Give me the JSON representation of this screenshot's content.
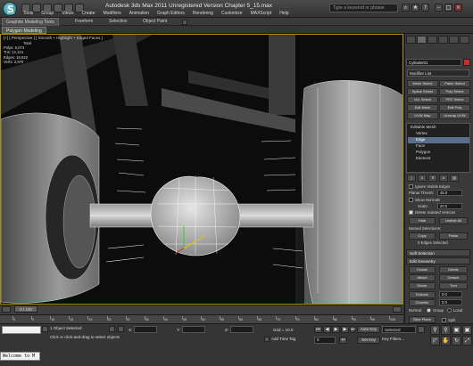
{
  "titlebar": {
    "title": "Autodesk 3ds Max  2011     Unregistered Version     Chapter 5_15.max",
    "search_placeholder": "Type a keyword or phrase",
    "menu": [
      "Edit",
      "Tools",
      "Group",
      "Views",
      "Create",
      "Modifiers",
      "Animation",
      "Graph Editors",
      "Rendering",
      "Customize",
      "MAXScript",
      "Help"
    ]
  },
  "ribbon": {
    "tabs": [
      "Graphite Modeling Tools",
      "Freeform",
      "Selection",
      "Object Paint"
    ],
    "sub_label": "Polygon Modeling"
  },
  "viewport": {
    "label": "[+] [ Perspective ] [ Smooth + Highlight + Edged Faces ]",
    "stats": {
      "header": "Total",
      "rows": [
        {
          "label": "Polys:",
          "value": "6,074"
        },
        {
          "label": "Tris:",
          "value": "12,124"
        },
        {
          "label": "Edges:",
          "value": "18,922"
        },
        {
          "label": "Verts:",
          "value": "2,970"
        }
      ]
    }
  },
  "panel": {
    "object_name": "Cylinder01",
    "modifier_list": "Modifier List",
    "buttons": [
      [
        "Mesh Select",
        "Patch Select"
      ],
      [
        "Spline Select",
        "Poly Select"
      ],
      [
        "Vol. Select",
        "FFD Select"
      ],
      [
        "Edit Mesh",
        "Edit Poly"
      ],
      [
        "UVW Map",
        "Unwrap UVW"
      ]
    ],
    "stack": {
      "items": [
        "Editable Mesh",
        "Vertex",
        "Edge",
        "Face",
        "Polygon",
        "Element"
      ],
      "selected_index": 2
    },
    "selection": {
      "ignore_visible": "Ignore Visible Edges",
      "planar_thresh_label": "Planar Thresh:",
      "planar_thresh_value": "45.0",
      "show_normals": "Show Normals",
      "scale_label": "Scale:",
      "scale_value": "20.0",
      "delete_isolated": "Delete Isolated Vertices",
      "hide": "Hide",
      "unhide_all": "Unhide All",
      "named_selections": "Named Selections:",
      "copy": "Copy",
      "paste": "Paste",
      "count": "0 Edges Selected"
    },
    "soft_selection": "Soft Selection",
    "edit_geometry": {
      "header": "Edit Geometry",
      "create": "Create",
      "delete": "Delete",
      "attach": "Attach",
      "detach": "Detach",
      "divide": "Divide",
      "turn": "Turn",
      "extrude_label": "Extrude",
      "extrude_value": "0.0",
      "chamfer_label": "Chamfer",
      "chamfer_value": "0.0",
      "normal_label": "Normal:",
      "group": "Group",
      "local": "Local",
      "slice_plane": "Slice Plane",
      "split": "Split",
      "cut": "Cut",
      "refine_ends": "Refine Ends"
    }
  },
  "timeline": {
    "slider": "0 / 100",
    "ticks": [
      "0",
      "5",
      "10",
      "15",
      "20",
      "25",
      "30",
      "35",
      "40",
      "45",
      "50",
      "55",
      "60",
      "65",
      "70",
      "75",
      "80",
      "85",
      "90",
      "95",
      "100"
    ]
  },
  "status": {
    "line1": "1 Object Selected",
    "line2": "Click or click-and-drag to select objects",
    "x_label": "X:",
    "y_label": "Y:",
    "z_label": "Z:",
    "grid": "Grid = 10.0",
    "add_time_tag": "Add Time Tag",
    "auto_key": "Auto Key",
    "selected": "Selected",
    "set_key": "Set Key",
    "key_filters": "Key Filters...",
    "script": "Welcome to M",
    "frame_value": "0"
  }
}
